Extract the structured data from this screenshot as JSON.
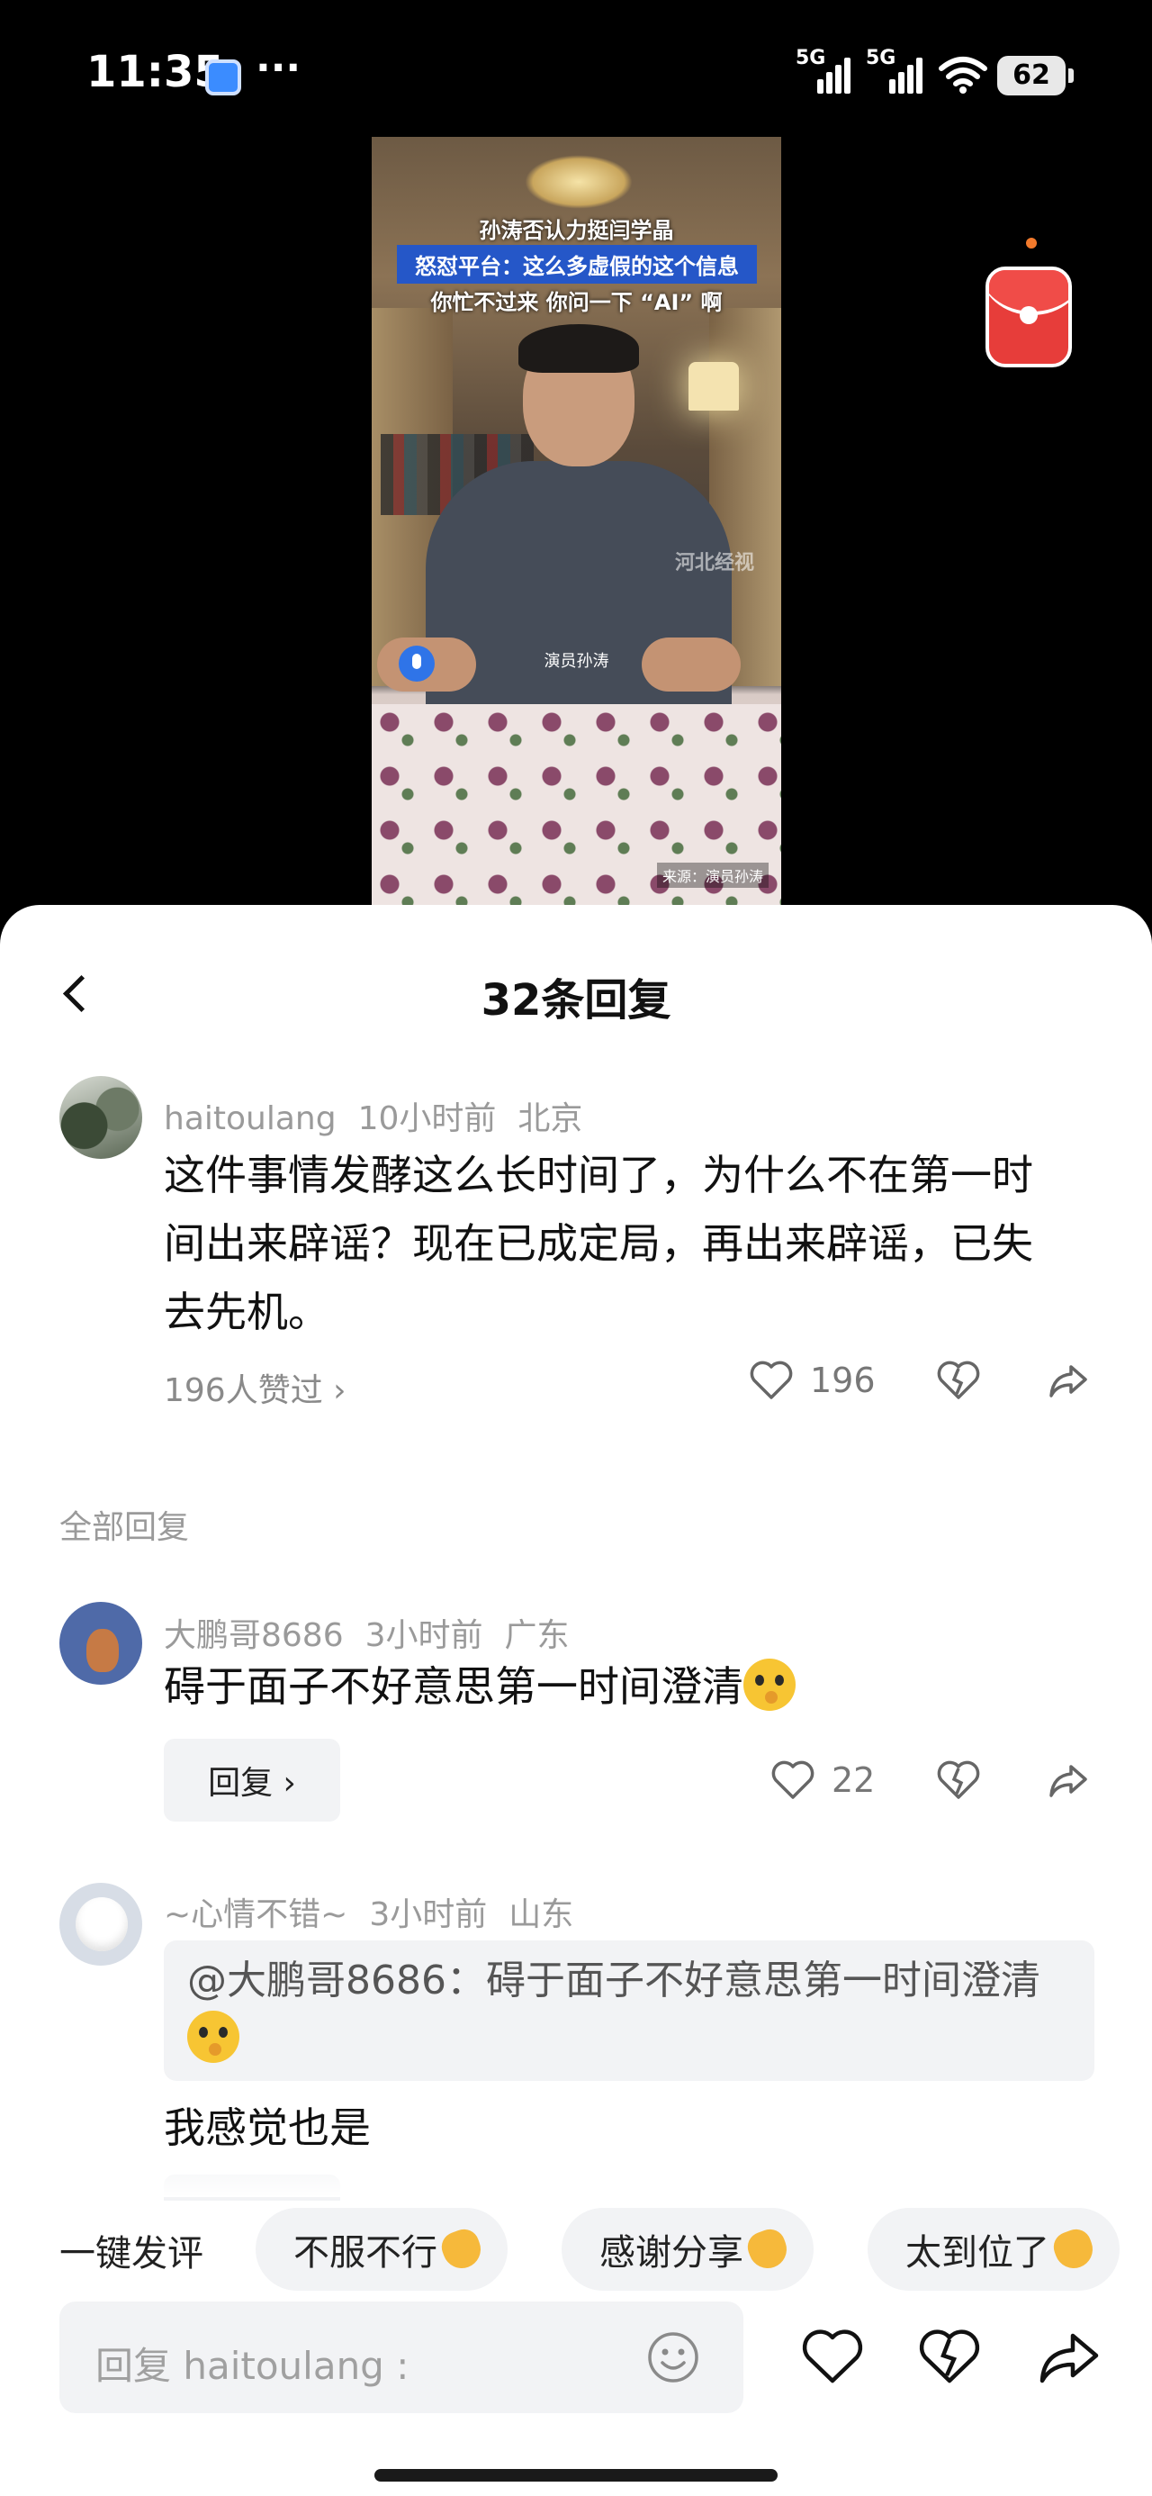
{
  "status_bar": {
    "time": "11:35",
    "dots": "···",
    "net1": "5G",
    "net2": "5G",
    "battery": "62"
  },
  "video": {
    "caption_line1": "孙涛否认力挺闫学晶",
    "caption_line2": "怒怼平台：这么多虚假的这个信息",
    "caption_line3": "你忙不过来  你问一下 “AI” 啊",
    "watermark": "河北经视",
    "speaker": "演员孙涛",
    "source": "来源：演员孙涛"
  },
  "sheet": {
    "title": "32条回复",
    "main_comment": {
      "user": "haitoulang",
      "time": "10小时前",
      "location": "北京",
      "text": "这件事情发酵这么长时间了，为什么不在第一时间出来辟谣？现在已成定局，再出来辟谣，已失去先机。",
      "likes_link": "196人赞过 ›",
      "like_count": "196"
    },
    "section_label": "全部回复",
    "replies": [
      {
        "user": "大鹏哥8686",
        "time": "3小时前",
        "location": "广东",
        "text": "碍于面子不好意思第一时间澄清",
        "reply_label": "回复 ›",
        "like_count": "22"
      },
      {
        "user": "~心情不错~",
        "time": "3小时前",
        "location": "山东",
        "quote": "@大鹏哥8686：碍于面子不好意思第一时间澄清",
        "text": "我感觉也是"
      }
    ],
    "quick_comment": {
      "label": "一键发评",
      "chips": [
        "不服不行",
        "感谢分享",
        "太到位了"
      ]
    },
    "input": {
      "placeholder": "回复 haitoulang :"
    }
  },
  "colors": {
    "red_packet": "#e73d3a",
    "video_caption_bg": "#2557c8",
    "chip_bg": "#f2f3f5"
  }
}
